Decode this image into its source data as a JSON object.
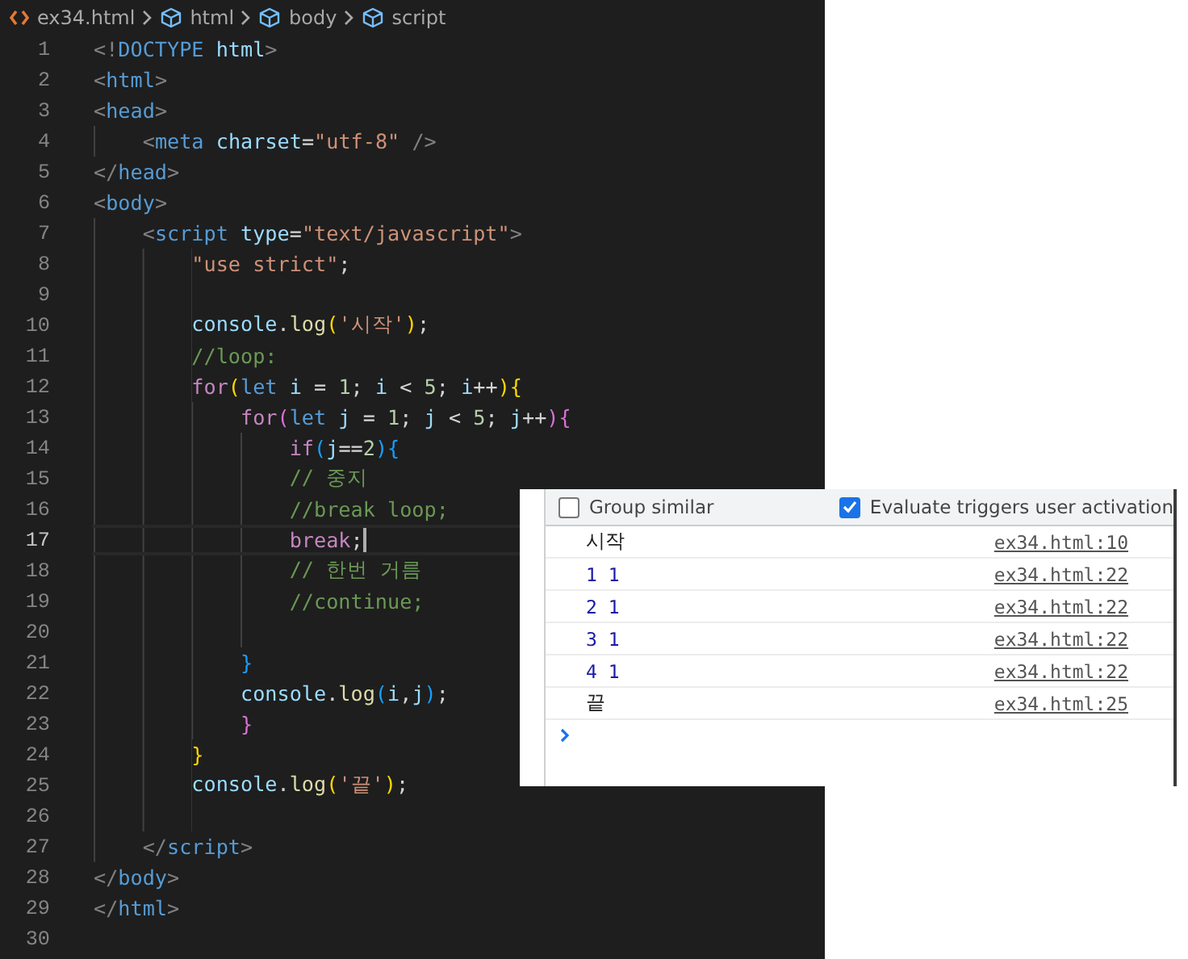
{
  "breadcrumb": [
    {
      "text": "ex34.html",
      "kind": "file"
    },
    {
      "text": "html",
      "kind": "element"
    },
    {
      "text": "body",
      "kind": "element"
    },
    {
      "text": "script",
      "kind": "element"
    }
  ],
  "lines": [
    {
      "number": "1",
      "current": false,
      "tokens": [
        {
          "text": "<!",
          "kind": "punct"
        },
        {
          "text": "DOCTYPE",
          "kind": "tag"
        },
        {
          "text": " html",
          "kind": "attr"
        },
        {
          "text": ">",
          "kind": "punct"
        }
      ]
    },
    {
      "number": "2",
      "current": false,
      "tokens": [
        {
          "text": "<",
          "kind": "punct"
        },
        {
          "text": "html",
          "kind": "tag"
        },
        {
          "text": ">",
          "kind": "punct"
        }
      ]
    },
    {
      "number": "3",
      "current": false,
      "tokens": [
        {
          "text": "<",
          "kind": "punct"
        },
        {
          "text": "head",
          "kind": "tag"
        },
        {
          "text": ">",
          "kind": "punct"
        }
      ]
    },
    {
      "number": "4",
      "current": false,
      "tokens": [
        {
          "text": "    <",
          "kind": "punct"
        },
        {
          "text": "meta",
          "kind": "tag"
        },
        {
          "text": " charset",
          "kind": "attr"
        },
        {
          "text": "=",
          "kind": "plain"
        },
        {
          "text": "\"utf-8\"",
          "kind": "string"
        },
        {
          "text": " />",
          "kind": "punct"
        }
      ]
    },
    {
      "number": "5",
      "current": false,
      "tokens": [
        {
          "text": "</",
          "kind": "punct"
        },
        {
          "text": "head",
          "kind": "tag"
        },
        {
          "text": ">",
          "kind": "punct"
        }
      ]
    },
    {
      "number": "6",
      "current": false,
      "tokens": [
        {
          "text": "<",
          "kind": "punct"
        },
        {
          "text": "body",
          "kind": "tag"
        },
        {
          "text": ">",
          "kind": "punct"
        }
      ]
    },
    {
      "number": "7",
      "current": false,
      "tokens": [
        {
          "text": "    <",
          "kind": "punct"
        },
        {
          "text": "script",
          "kind": "tag"
        },
        {
          "text": " type",
          "kind": "attr"
        },
        {
          "text": "=",
          "kind": "plain"
        },
        {
          "text": "\"text/javascript\"",
          "kind": "string"
        },
        {
          "text": ">",
          "kind": "punct"
        }
      ]
    },
    {
      "number": "8",
      "current": false,
      "tokens": [
        {
          "text": "        \"use strict\"",
          "kind": "string"
        },
        {
          "text": ";",
          "kind": "plain"
        }
      ]
    },
    {
      "number": "9",
      "current": false
    },
    {
      "number": "10",
      "current": false,
      "tokens": [
        {
          "text": "        console",
          "kind": "variable"
        },
        {
          "text": ".",
          "kind": "plain"
        },
        {
          "text": "log",
          "kind": "function"
        },
        {
          "text": "(",
          "kind": "bracket1"
        },
        {
          "text": "'시작'",
          "kind": "string"
        },
        {
          "text": ")",
          "kind": "bracket1"
        },
        {
          "text": ";",
          "kind": "plain"
        }
      ]
    },
    {
      "number": "11",
      "current": false,
      "tokens": [
        {
          "text": "        //loop:",
          "kind": "comment"
        }
      ]
    },
    {
      "number": "12",
      "current": false,
      "tokens": [
        {
          "text": "        for",
          "kind": "control"
        },
        {
          "text": "(",
          "kind": "bracket1"
        },
        {
          "text": "let",
          "kind": "storage"
        },
        {
          "text": " i",
          "kind": "variable"
        },
        {
          "text": " = ",
          "kind": "plain"
        },
        {
          "text": "1",
          "kind": "number"
        },
        {
          "text": "; ",
          "kind": "plain"
        },
        {
          "text": "i",
          "kind": "variable"
        },
        {
          "text": " < ",
          "kind": "plain"
        },
        {
          "text": "5",
          "kind": "number"
        },
        {
          "text": "; ",
          "kind": "plain"
        },
        {
          "text": "i",
          "kind": "variable"
        },
        {
          "text": "++",
          "kind": "plain"
        },
        {
          "text": ")",
          "kind": "bracket1"
        },
        {
          "text": "{",
          "kind": "bracket1"
        }
      ]
    },
    {
      "number": "13",
      "current": false,
      "tokens": [
        {
          "text": "            for",
          "kind": "control"
        },
        {
          "text": "(",
          "kind": "bracket2"
        },
        {
          "text": "let",
          "kind": "storage"
        },
        {
          "text": " j",
          "kind": "variable"
        },
        {
          "text": " = ",
          "kind": "plain"
        },
        {
          "text": "1",
          "kind": "number"
        },
        {
          "text": "; ",
          "kind": "plain"
        },
        {
          "text": "j",
          "kind": "variable"
        },
        {
          "text": " < ",
          "kind": "plain"
        },
        {
          "text": "5",
          "kind": "number"
        },
        {
          "text": "; ",
          "kind": "plain"
        },
        {
          "text": "j",
          "kind": "variable"
        },
        {
          "text": "++",
          "kind": "plain"
        },
        {
          "text": ")",
          "kind": "bracket2"
        },
        {
          "text": "{",
          "kind": "bracket2"
        }
      ]
    },
    {
      "number": "14",
      "current": false,
      "tokens": [
        {
          "text": "                if",
          "kind": "control"
        },
        {
          "text": "(",
          "kind": "bracket3"
        },
        {
          "text": "j",
          "kind": "variable"
        },
        {
          "text": "==",
          "kind": "plain"
        },
        {
          "text": "2",
          "kind": "number"
        },
        {
          "text": ")",
          "kind": "bracket3"
        },
        {
          "text": "{",
          "kind": "bracket3"
        }
      ]
    },
    {
      "number": "15",
      "current": false,
      "tokens": [
        {
          "text": "                // 중지",
          "kind": "comment"
        }
      ]
    },
    {
      "number": "16",
      "current": false,
      "tokens": [
        {
          "text": "                //break loop;",
          "kind": "comment"
        }
      ]
    },
    {
      "number": "17",
      "current": true,
      "tokens": [
        {
          "text": "                break",
          "kind": "control"
        },
        {
          "text": ";",
          "kind": "plain"
        }
      ]
    },
    {
      "number": "18",
      "current": false,
      "tokens": [
        {
          "text": "                // 한번 거름",
          "kind": "comment"
        }
      ]
    },
    {
      "number": "19",
      "current": false,
      "tokens": [
        {
          "text": "                //continue;",
          "kind": "comment"
        }
      ]
    },
    {
      "number": "20",
      "current": false
    },
    {
      "number": "21",
      "current": false,
      "tokens": [
        {
          "text": "            }",
          "kind": "bracket3"
        }
      ]
    },
    {
      "number": "22",
      "current": false,
      "tokens": [
        {
          "text": "            console",
          "kind": "variable"
        },
        {
          "text": ".",
          "kind": "plain"
        },
        {
          "text": "log",
          "kind": "function"
        },
        {
          "text": "(",
          "kind": "bracket3"
        },
        {
          "text": "i",
          "kind": "variable"
        },
        {
          "text": ",",
          "kind": "plain"
        },
        {
          "text": "j",
          "kind": "variable"
        },
        {
          "text": ")",
          "kind": "bracket3"
        },
        {
          "text": ";",
          "kind": "plain"
        }
      ]
    },
    {
      "number": "23",
      "current": false,
      "tokens": [
        {
          "text": "            }",
          "kind": "bracket2"
        }
      ]
    },
    {
      "number": "24",
      "current": false,
      "tokens": [
        {
          "text": "        }",
          "kind": "bracket1"
        }
      ]
    },
    {
      "number": "25",
      "current": false,
      "tokens": [
        {
          "text": "        console",
          "kind": "variable"
        },
        {
          "text": ".",
          "kind": "plain"
        },
        {
          "text": "log",
          "kind": "function"
        },
        {
          "text": "(",
          "kind": "bracket1"
        },
        {
          "text": "'끝'",
          "kind": "string"
        },
        {
          "text": ")",
          "kind": "bracket1"
        },
        {
          "text": ";",
          "kind": "plain"
        }
      ]
    },
    {
      "number": "26",
      "current": false
    },
    {
      "number": "27",
      "current": false,
      "tokens": [
        {
          "text": "    </",
          "kind": "punct"
        },
        {
          "text": "script",
          "kind": "tag"
        },
        {
          "text": ">",
          "kind": "punct"
        }
      ]
    },
    {
      "number": "28",
      "current": false,
      "tokens": [
        {
          "text": "</",
          "kind": "punct"
        },
        {
          "text": "body",
          "kind": "tag"
        },
        {
          "text": ">",
          "kind": "punct"
        }
      ]
    },
    {
      "number": "29",
      "current": false,
      "tokens": [
        {
          "text": "</",
          "kind": "punct"
        },
        {
          "text": "html",
          "kind": "tag"
        },
        {
          "text": ">",
          "kind": "punct"
        }
      ]
    },
    {
      "number": "30",
      "current": false
    }
  ],
  "console": {
    "options": [
      {
        "label": "Group similar",
        "checked": false
      },
      {
        "label": "Evaluate triggers user activation",
        "checked": true
      }
    ],
    "messages": [
      {
        "text": "시작",
        "kind": "string",
        "source": "ex34.html:10"
      },
      {
        "text": "1 1",
        "kind": "numbers",
        "source": "ex34.html:22"
      },
      {
        "text": "2 1",
        "kind": "numbers",
        "source": "ex34.html:22"
      },
      {
        "text": "3 1",
        "kind": "numbers",
        "source": "ex34.html:22"
      },
      {
        "text": "4 1",
        "kind": "numbers",
        "source": "ex34.html:22"
      },
      {
        "text": "끝",
        "kind": "string",
        "source": "ex34.html:25"
      }
    ]
  }
}
